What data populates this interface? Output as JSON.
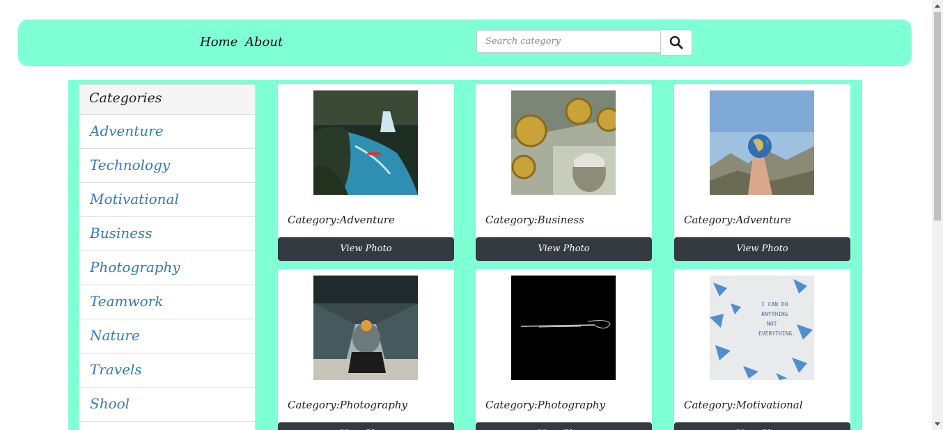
{
  "nav": {
    "links": [
      {
        "label": "Home"
      },
      {
        "label": "About"
      }
    ],
    "search": {
      "placeholder": "Search category",
      "value": "",
      "icon": "search-icon"
    }
  },
  "sidebar": {
    "heading": "Categories",
    "items": [
      {
        "label": "Adventure"
      },
      {
        "label": "Technology"
      },
      {
        "label": "Motivational"
      },
      {
        "label": "Business"
      },
      {
        "label": "Photography"
      },
      {
        "label": "Teamwork"
      },
      {
        "label": "Nature"
      },
      {
        "label": "Travels"
      },
      {
        "label": "Shool"
      }
    ]
  },
  "cards": [
    {
      "category": "Category:Adventure",
      "button": "View Photo",
      "image": "waterfall-kayak"
    },
    {
      "category": "Category:Business",
      "button": "View Photo",
      "image": "bitcoin-dollars"
    },
    {
      "category": "Category:Adventure",
      "button": "View Photo",
      "image": "hand-globe"
    },
    {
      "category": "Category:Photography",
      "button": "View Photo",
      "image": "escalator-person"
    },
    {
      "category": "Category:Photography",
      "button": "View Photo",
      "image": "dark-lightstreak"
    },
    {
      "category": "Category:Motivational",
      "button": "View Photo",
      "image": "can-do-anything-note"
    }
  ],
  "colors": {
    "accent": "#7fffd4",
    "link": "#337ab7",
    "button": "#343a40"
  }
}
